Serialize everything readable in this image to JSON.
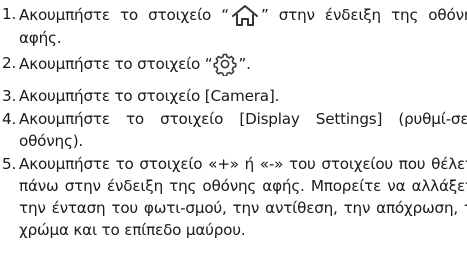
{
  "steps": [
    {
      "number": "1.",
      "before_icon": "Ακουμπήστε το στοιχείο “",
      "icon": "home-icon",
      "after_icon": "” στην ένδειξη της οθόνης αφής."
    },
    {
      "number": "2.",
      "before_icon": "Ακουμπήστε το στοιχείο “",
      "icon": "gear-icon",
      "after_icon": "”."
    },
    {
      "number": "3.",
      "text": "Ακουμπήστε το στοιχείο [Camera]."
    },
    {
      "number": "4.",
      "text": "Ακουμπήστε το στοιχείο [Display Settings] (ρυθμί-σεις οθόνης)."
    },
    {
      "number": "5.",
      "text": "Ακουμπήστε το στοιχείο «+» ή «-» του στοιχείου που θέλετε πάνω στην ένδειξη της οθόνης αφής. Μπορείτε να αλλάξετε την ένταση του φωτι-σμού, την αντίθεση, την απόχρωση, το χρώμα και το επίπεδο μαύρου."
    }
  ],
  "colors": {
    "text": "#1a1a1a",
    "icon": "#333333"
  }
}
